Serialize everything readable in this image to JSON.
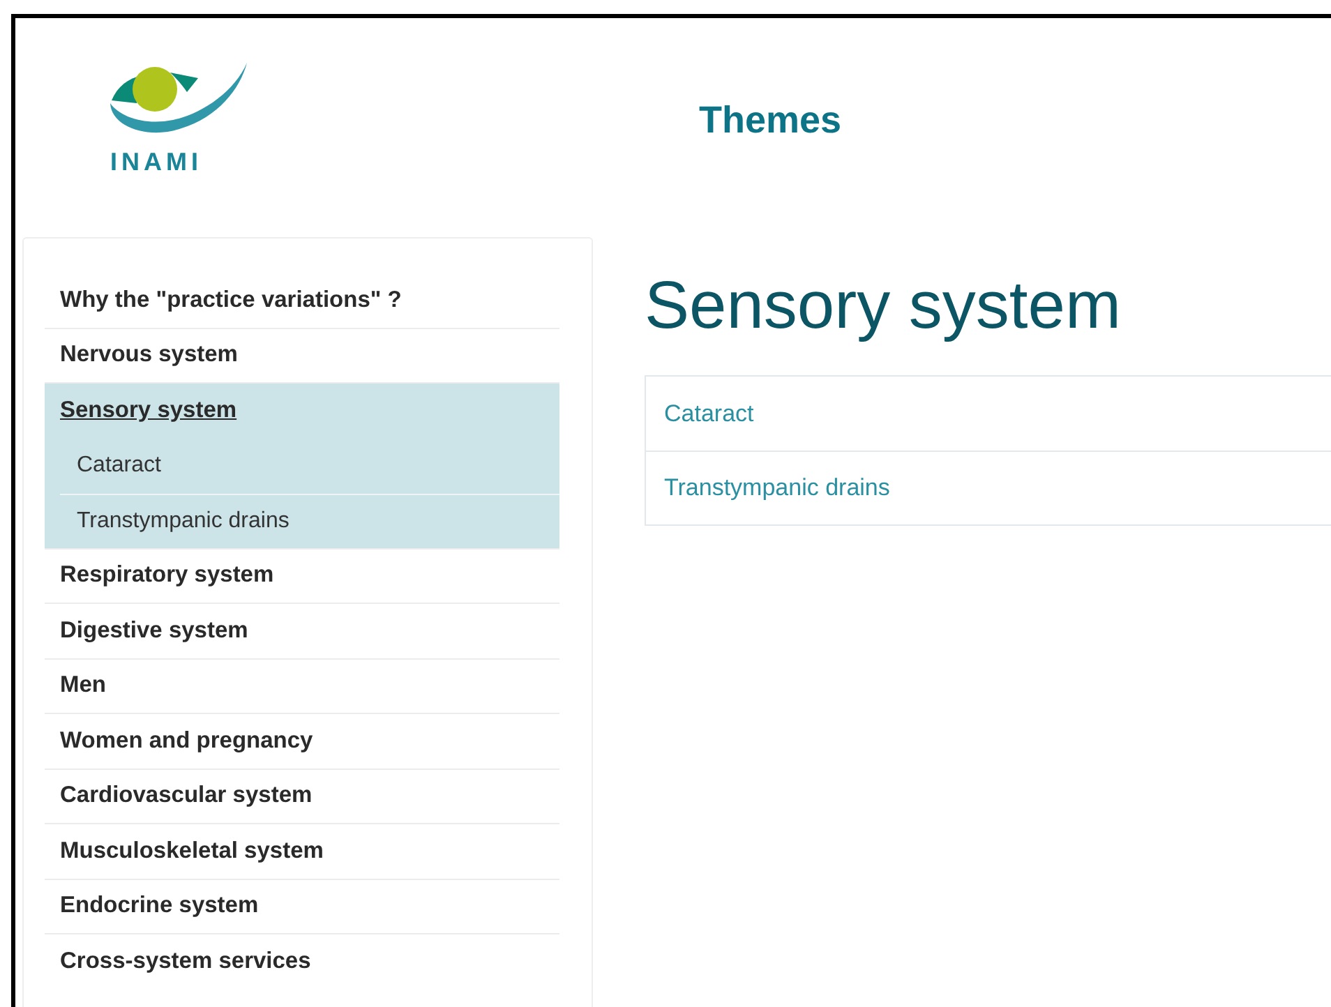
{
  "logo": {
    "text": "INAMI"
  },
  "header": {
    "title": "Themes"
  },
  "sidebar": {
    "items": [
      {
        "label": "Why the \"practice variations\" ?",
        "selected": false
      },
      {
        "label": "Nervous system",
        "selected": false
      },
      {
        "label": "Sensory system",
        "selected": true,
        "children": [
          {
            "label": "Cataract"
          },
          {
            "label": "Transtympanic drains"
          }
        ]
      },
      {
        "label": "Respiratory system",
        "selected": false
      },
      {
        "label": "Digestive system",
        "selected": false
      },
      {
        "label": "Men",
        "selected": false
      },
      {
        "label": "Women and pregnancy",
        "selected": false
      },
      {
        "label": "Cardiovascular system",
        "selected": false
      },
      {
        "label": "Musculoskeletal system",
        "selected": false
      },
      {
        "label": "Endocrine system",
        "selected": false
      },
      {
        "label": "Cross-system services",
        "selected": false
      }
    ]
  },
  "main": {
    "heading": "Sensory system",
    "links": [
      "Cataract",
      "Transtympanic drains"
    ]
  }
}
